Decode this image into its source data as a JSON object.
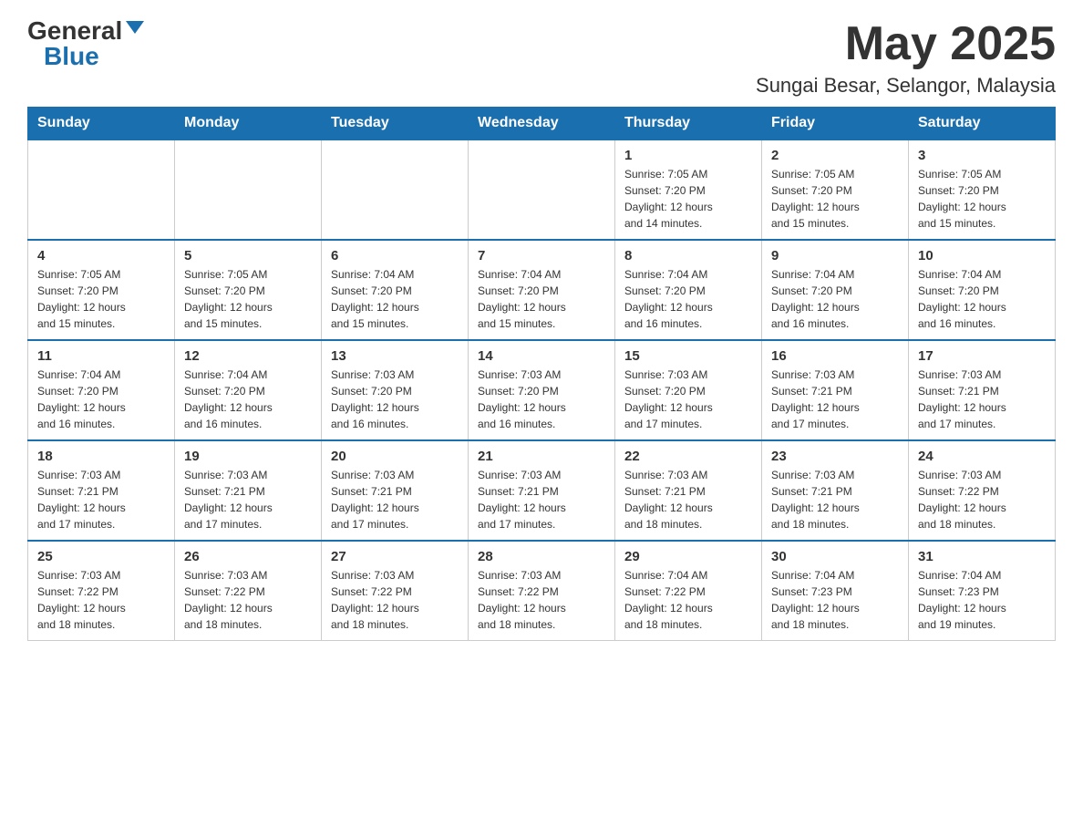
{
  "header": {
    "logo_general": "General",
    "logo_blue": "Blue",
    "month_title": "May 2025",
    "location": "Sungai Besar, Selangor, Malaysia"
  },
  "days_of_week": [
    "Sunday",
    "Monday",
    "Tuesday",
    "Wednesday",
    "Thursday",
    "Friday",
    "Saturday"
  ],
  "weeks": [
    [
      {
        "day": "",
        "info": ""
      },
      {
        "day": "",
        "info": ""
      },
      {
        "day": "",
        "info": ""
      },
      {
        "day": "",
        "info": ""
      },
      {
        "day": "1",
        "info": "Sunrise: 7:05 AM\nSunset: 7:20 PM\nDaylight: 12 hours\nand 14 minutes."
      },
      {
        "day": "2",
        "info": "Sunrise: 7:05 AM\nSunset: 7:20 PM\nDaylight: 12 hours\nand 15 minutes."
      },
      {
        "day": "3",
        "info": "Sunrise: 7:05 AM\nSunset: 7:20 PM\nDaylight: 12 hours\nand 15 minutes."
      }
    ],
    [
      {
        "day": "4",
        "info": "Sunrise: 7:05 AM\nSunset: 7:20 PM\nDaylight: 12 hours\nand 15 minutes."
      },
      {
        "day": "5",
        "info": "Sunrise: 7:05 AM\nSunset: 7:20 PM\nDaylight: 12 hours\nand 15 minutes."
      },
      {
        "day": "6",
        "info": "Sunrise: 7:04 AM\nSunset: 7:20 PM\nDaylight: 12 hours\nand 15 minutes."
      },
      {
        "day": "7",
        "info": "Sunrise: 7:04 AM\nSunset: 7:20 PM\nDaylight: 12 hours\nand 15 minutes."
      },
      {
        "day": "8",
        "info": "Sunrise: 7:04 AM\nSunset: 7:20 PM\nDaylight: 12 hours\nand 16 minutes."
      },
      {
        "day": "9",
        "info": "Sunrise: 7:04 AM\nSunset: 7:20 PM\nDaylight: 12 hours\nand 16 minutes."
      },
      {
        "day": "10",
        "info": "Sunrise: 7:04 AM\nSunset: 7:20 PM\nDaylight: 12 hours\nand 16 minutes."
      }
    ],
    [
      {
        "day": "11",
        "info": "Sunrise: 7:04 AM\nSunset: 7:20 PM\nDaylight: 12 hours\nand 16 minutes."
      },
      {
        "day": "12",
        "info": "Sunrise: 7:04 AM\nSunset: 7:20 PM\nDaylight: 12 hours\nand 16 minutes."
      },
      {
        "day": "13",
        "info": "Sunrise: 7:03 AM\nSunset: 7:20 PM\nDaylight: 12 hours\nand 16 minutes."
      },
      {
        "day": "14",
        "info": "Sunrise: 7:03 AM\nSunset: 7:20 PM\nDaylight: 12 hours\nand 16 minutes."
      },
      {
        "day": "15",
        "info": "Sunrise: 7:03 AM\nSunset: 7:20 PM\nDaylight: 12 hours\nand 17 minutes."
      },
      {
        "day": "16",
        "info": "Sunrise: 7:03 AM\nSunset: 7:21 PM\nDaylight: 12 hours\nand 17 minutes."
      },
      {
        "day": "17",
        "info": "Sunrise: 7:03 AM\nSunset: 7:21 PM\nDaylight: 12 hours\nand 17 minutes."
      }
    ],
    [
      {
        "day": "18",
        "info": "Sunrise: 7:03 AM\nSunset: 7:21 PM\nDaylight: 12 hours\nand 17 minutes."
      },
      {
        "day": "19",
        "info": "Sunrise: 7:03 AM\nSunset: 7:21 PM\nDaylight: 12 hours\nand 17 minutes."
      },
      {
        "day": "20",
        "info": "Sunrise: 7:03 AM\nSunset: 7:21 PM\nDaylight: 12 hours\nand 17 minutes."
      },
      {
        "day": "21",
        "info": "Sunrise: 7:03 AM\nSunset: 7:21 PM\nDaylight: 12 hours\nand 17 minutes."
      },
      {
        "day": "22",
        "info": "Sunrise: 7:03 AM\nSunset: 7:21 PM\nDaylight: 12 hours\nand 18 minutes."
      },
      {
        "day": "23",
        "info": "Sunrise: 7:03 AM\nSunset: 7:21 PM\nDaylight: 12 hours\nand 18 minutes."
      },
      {
        "day": "24",
        "info": "Sunrise: 7:03 AM\nSunset: 7:22 PM\nDaylight: 12 hours\nand 18 minutes."
      }
    ],
    [
      {
        "day": "25",
        "info": "Sunrise: 7:03 AM\nSunset: 7:22 PM\nDaylight: 12 hours\nand 18 minutes."
      },
      {
        "day": "26",
        "info": "Sunrise: 7:03 AM\nSunset: 7:22 PM\nDaylight: 12 hours\nand 18 minutes."
      },
      {
        "day": "27",
        "info": "Sunrise: 7:03 AM\nSunset: 7:22 PM\nDaylight: 12 hours\nand 18 minutes."
      },
      {
        "day": "28",
        "info": "Sunrise: 7:03 AM\nSunset: 7:22 PM\nDaylight: 12 hours\nand 18 minutes."
      },
      {
        "day": "29",
        "info": "Sunrise: 7:04 AM\nSunset: 7:22 PM\nDaylight: 12 hours\nand 18 minutes."
      },
      {
        "day": "30",
        "info": "Sunrise: 7:04 AM\nSunset: 7:23 PM\nDaylight: 12 hours\nand 18 minutes."
      },
      {
        "day": "31",
        "info": "Sunrise: 7:04 AM\nSunset: 7:23 PM\nDaylight: 12 hours\nand 19 minutes."
      }
    ]
  ]
}
